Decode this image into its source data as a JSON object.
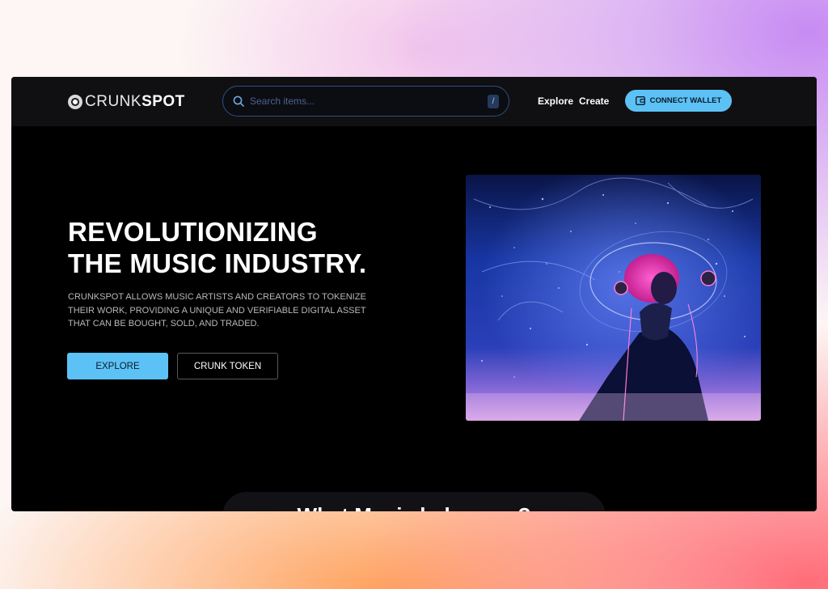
{
  "brand": {
    "name_part1": "CRUNK",
    "name_part2": "SPOT"
  },
  "search": {
    "placeholder": "Search items...",
    "shortcut": "/"
  },
  "nav": {
    "explore": "Explore",
    "create": "Create",
    "connect_wallet": "CONNECT WALLET"
  },
  "hero": {
    "title_line1": "REVOLUTIONIZING",
    "title_line2": "THE MUSIC INDUSTRY.",
    "description": "CRUNKSPOT ALLOWS MUSIC ARTISTS AND CREATORS TO TOKENIZE THEIR WORK, PROVIDING A UNIQUE AND VERIFIABLE DIGITAL ASSET THAT CAN BE BOUGHT, SOLD, AND TRADED.",
    "explore_button": "EXPLORE",
    "token_button": "CRUNK TOKEN"
  },
  "section": {
    "heading": "What Music helps you?"
  },
  "colors": {
    "accent": "#5cc2f5",
    "background": "#000000",
    "navbar": "#101012"
  }
}
